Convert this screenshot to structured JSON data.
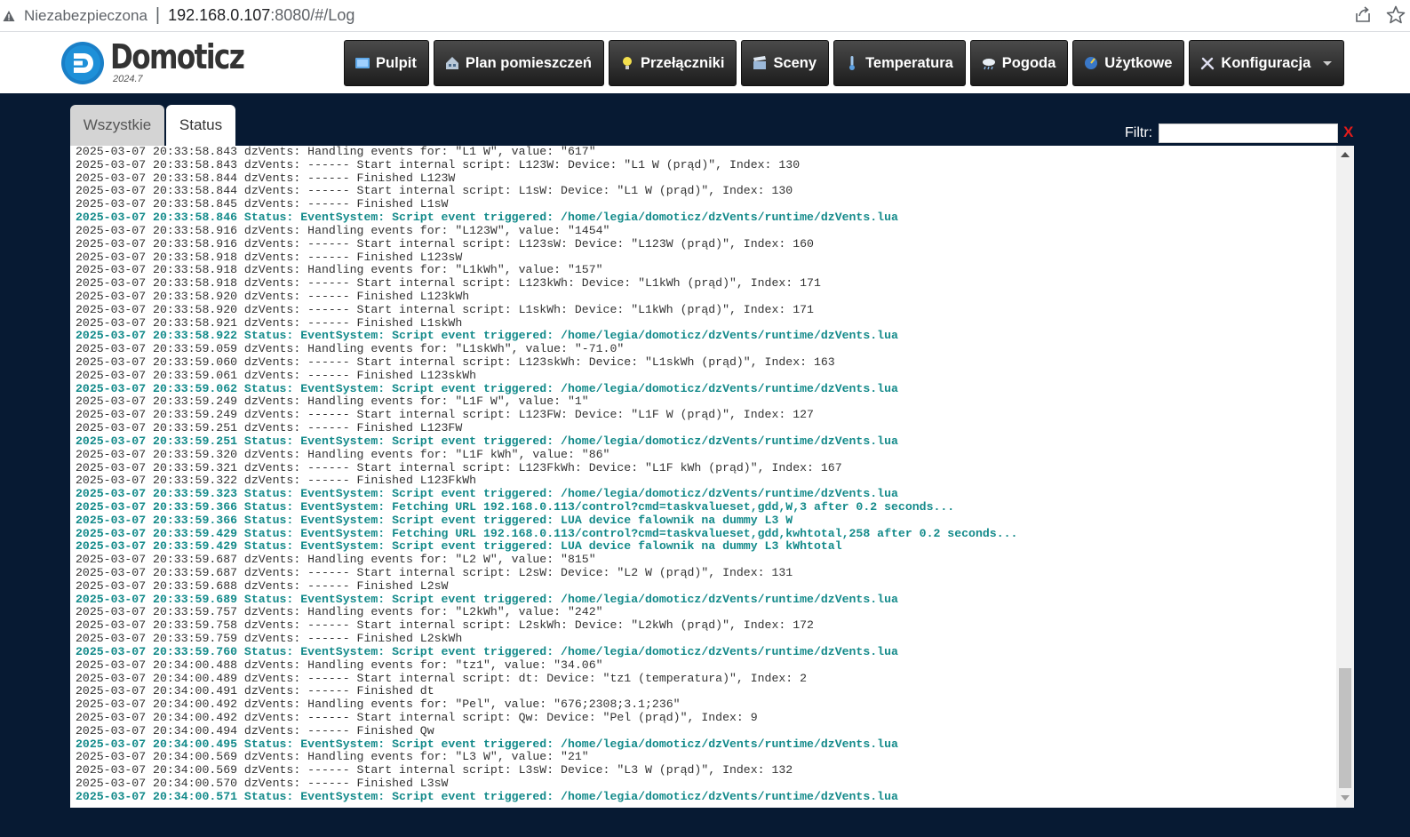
{
  "browser": {
    "security_label": "Niezabezpieczona",
    "separator": "|",
    "url_host": "192.168.0.107",
    "url_rest": ":8080/#/Log"
  },
  "app": {
    "brand": "Domoticz",
    "version": "2024.7"
  },
  "nav": [
    {
      "label": "Pulpit",
      "icon": "dashboard-icon"
    },
    {
      "label": "Plan pomieszczeń",
      "icon": "house-plan-icon"
    },
    {
      "label": "Przełączniki",
      "icon": "lightbulb-icon"
    },
    {
      "label": "Sceny",
      "icon": "clapperboard-icon"
    },
    {
      "label": "Temperatura",
      "icon": "thermometer-icon"
    },
    {
      "label": "Pogoda",
      "icon": "weather-cloud-icon"
    },
    {
      "label": "Użytkowe",
      "icon": "utility-gauge-icon"
    },
    {
      "label": "Konfiguracja",
      "icon": "tools-icon"
    }
  ],
  "tabs": {
    "all": "Wszystkie",
    "status": "Status"
  },
  "filter": {
    "label": "Filtr:",
    "value": "",
    "clear": "X"
  },
  "log": [
    {
      "t": "2025-03-07 20:33:58.843 dzVents: Handling events for: \"L1 W\", value: \"617\"",
      "s": false
    },
    {
      "t": "2025-03-07 20:33:58.843 dzVents: ------ Start internal script: L123W: Device: \"L1 W (prąd)\", Index: 130",
      "s": false
    },
    {
      "t": "2025-03-07 20:33:58.844 dzVents: ------ Finished L123W",
      "s": false
    },
    {
      "t": "2025-03-07 20:33:58.844 dzVents: ------ Start internal script: L1sW: Device: \"L1 W (prąd)\", Index: 130",
      "s": false
    },
    {
      "t": "2025-03-07 20:33:58.845 dzVents: ------ Finished L1sW",
      "s": false
    },
    {
      "t": "2025-03-07 20:33:58.846 Status: EventSystem: Script event triggered: /home/legia/domoticz/dzVents/runtime/dzVents.lua",
      "s": true
    },
    {
      "t": "2025-03-07 20:33:58.916 dzVents: Handling events for: \"L123W\", value: \"1454\"",
      "s": false
    },
    {
      "t": "2025-03-07 20:33:58.916 dzVents: ------ Start internal script: L123sW: Device: \"L123W (prąd)\", Index: 160",
      "s": false
    },
    {
      "t": "2025-03-07 20:33:58.918 dzVents: ------ Finished L123sW",
      "s": false
    },
    {
      "t": "2025-03-07 20:33:58.918 dzVents: Handling events for: \"L1kWh\", value: \"157\"",
      "s": false
    },
    {
      "t": "2025-03-07 20:33:58.918 dzVents: ------ Start internal script: L123kWh: Device: \"L1kWh (prąd)\", Index: 171",
      "s": false
    },
    {
      "t": "2025-03-07 20:33:58.920 dzVents: ------ Finished L123kWh",
      "s": false
    },
    {
      "t": "2025-03-07 20:33:58.920 dzVents: ------ Start internal script: L1skWh: Device: \"L1kWh (prąd)\", Index: 171",
      "s": false
    },
    {
      "t": "2025-03-07 20:33:58.921 dzVents: ------ Finished L1skWh",
      "s": false
    },
    {
      "t": "2025-03-07 20:33:58.922 Status: EventSystem: Script event triggered: /home/legia/domoticz/dzVents/runtime/dzVents.lua",
      "s": true
    },
    {
      "t": "2025-03-07 20:33:59.059 dzVents: Handling events for: \"L1skWh\", value: \"-71.0\"",
      "s": false
    },
    {
      "t": "2025-03-07 20:33:59.060 dzVents: ------ Start internal script: L123skWh: Device: \"L1skWh (prąd)\", Index: 163",
      "s": false
    },
    {
      "t": "2025-03-07 20:33:59.061 dzVents: ------ Finished L123skWh",
      "s": false
    },
    {
      "t": "2025-03-07 20:33:59.062 Status: EventSystem: Script event triggered: /home/legia/domoticz/dzVents/runtime/dzVents.lua",
      "s": true
    },
    {
      "t": "2025-03-07 20:33:59.249 dzVents: Handling events for: \"L1F W\", value: \"1\"",
      "s": false
    },
    {
      "t": "2025-03-07 20:33:59.249 dzVents: ------ Start internal script: L123FW: Device: \"L1F W (prąd)\", Index: 127",
      "s": false
    },
    {
      "t": "2025-03-07 20:33:59.251 dzVents: ------ Finished L123FW",
      "s": false
    },
    {
      "t": "2025-03-07 20:33:59.251 Status: EventSystem: Script event triggered: /home/legia/domoticz/dzVents/runtime/dzVents.lua",
      "s": true
    },
    {
      "t": "2025-03-07 20:33:59.320 dzVents: Handling events for: \"L1F kWh\", value: \"86\"",
      "s": false
    },
    {
      "t": "2025-03-07 20:33:59.321 dzVents: ------ Start internal script: L123FkWh: Device: \"L1F kWh (prąd)\", Index: 167",
      "s": false
    },
    {
      "t": "2025-03-07 20:33:59.322 dzVents: ------ Finished L123FkWh",
      "s": false
    },
    {
      "t": "2025-03-07 20:33:59.323 Status: EventSystem: Script event triggered: /home/legia/domoticz/dzVents/runtime/dzVents.lua",
      "s": true
    },
    {
      "t": "2025-03-07 20:33:59.366 Status: EventSystem: Fetching URL 192.168.0.113/control?cmd=taskvalueset,gdd,W,3 after 0.2 seconds...",
      "s": true
    },
    {
      "t": "2025-03-07 20:33:59.366 Status: EventSystem: Script event triggered: LUA device falownik na dummy L3 W",
      "s": true
    },
    {
      "t": "2025-03-07 20:33:59.429 Status: EventSystem: Fetching URL 192.168.0.113/control?cmd=taskvalueset,gdd,kwhtotal,258 after 0.2 seconds...",
      "s": true
    },
    {
      "t": "2025-03-07 20:33:59.429 Status: EventSystem: Script event triggered: LUA device falownik na dummy L3 kWhtotal",
      "s": true
    },
    {
      "t": "2025-03-07 20:33:59.687 dzVents: Handling events for: \"L2 W\", value: \"815\"",
      "s": false
    },
    {
      "t": "2025-03-07 20:33:59.687 dzVents: ------ Start internal script: L2sW: Device: \"L2 W (prąd)\", Index: 131",
      "s": false
    },
    {
      "t": "2025-03-07 20:33:59.688 dzVents: ------ Finished L2sW",
      "s": false
    },
    {
      "t": "2025-03-07 20:33:59.689 Status: EventSystem: Script event triggered: /home/legia/domoticz/dzVents/runtime/dzVents.lua",
      "s": true
    },
    {
      "t": "2025-03-07 20:33:59.757 dzVents: Handling events for: \"L2kWh\", value: \"242\"",
      "s": false
    },
    {
      "t": "2025-03-07 20:33:59.758 dzVents: ------ Start internal script: L2skWh: Device: \"L2kWh (prąd)\", Index: 172",
      "s": false
    },
    {
      "t": "2025-03-07 20:33:59.759 dzVents: ------ Finished L2skWh",
      "s": false
    },
    {
      "t": "2025-03-07 20:33:59.760 Status: EventSystem: Script event triggered: /home/legia/domoticz/dzVents/runtime/dzVents.lua",
      "s": true
    },
    {
      "t": "2025-03-07 20:34:00.488 dzVents: Handling events for: \"tz1\", value: \"34.06\"",
      "s": false
    },
    {
      "t": "2025-03-07 20:34:00.489 dzVents: ------ Start internal script: dt: Device: \"tz1 (temperatura)\", Index: 2",
      "s": false
    },
    {
      "t": "2025-03-07 20:34:00.491 dzVents: ------ Finished dt",
      "s": false
    },
    {
      "t": "2025-03-07 20:34:00.492 dzVents: Handling events for: \"Pel\", value: \"676;2308;3.1;236\"",
      "s": false
    },
    {
      "t": "2025-03-07 20:34:00.492 dzVents: ------ Start internal script: Qw: Device: \"Pel (prąd)\", Index: 9",
      "s": false
    },
    {
      "t": "2025-03-07 20:34:00.494 dzVents: ------ Finished Qw",
      "s": false
    },
    {
      "t": "2025-03-07 20:34:00.495 Status: EventSystem: Script event triggered: /home/legia/domoticz/dzVents/runtime/dzVents.lua",
      "s": true
    },
    {
      "t": "2025-03-07 20:34:00.569 dzVents: Handling events for: \"L3 W\", value: \"21\"",
      "s": false
    },
    {
      "t": "2025-03-07 20:34:00.569 dzVents: ------ Start internal script: L3sW: Device: \"L3 W (prąd)\", Index: 132",
      "s": false
    },
    {
      "t": "2025-03-07 20:34:00.570 dzVents: ------ Finished L3sW",
      "s": false
    },
    {
      "t": "2025-03-07 20:34:00.571 Status: EventSystem: Script event triggered: /home/legia/domoticz/dzVents/runtime/dzVents.lua",
      "s": true
    }
  ]
}
